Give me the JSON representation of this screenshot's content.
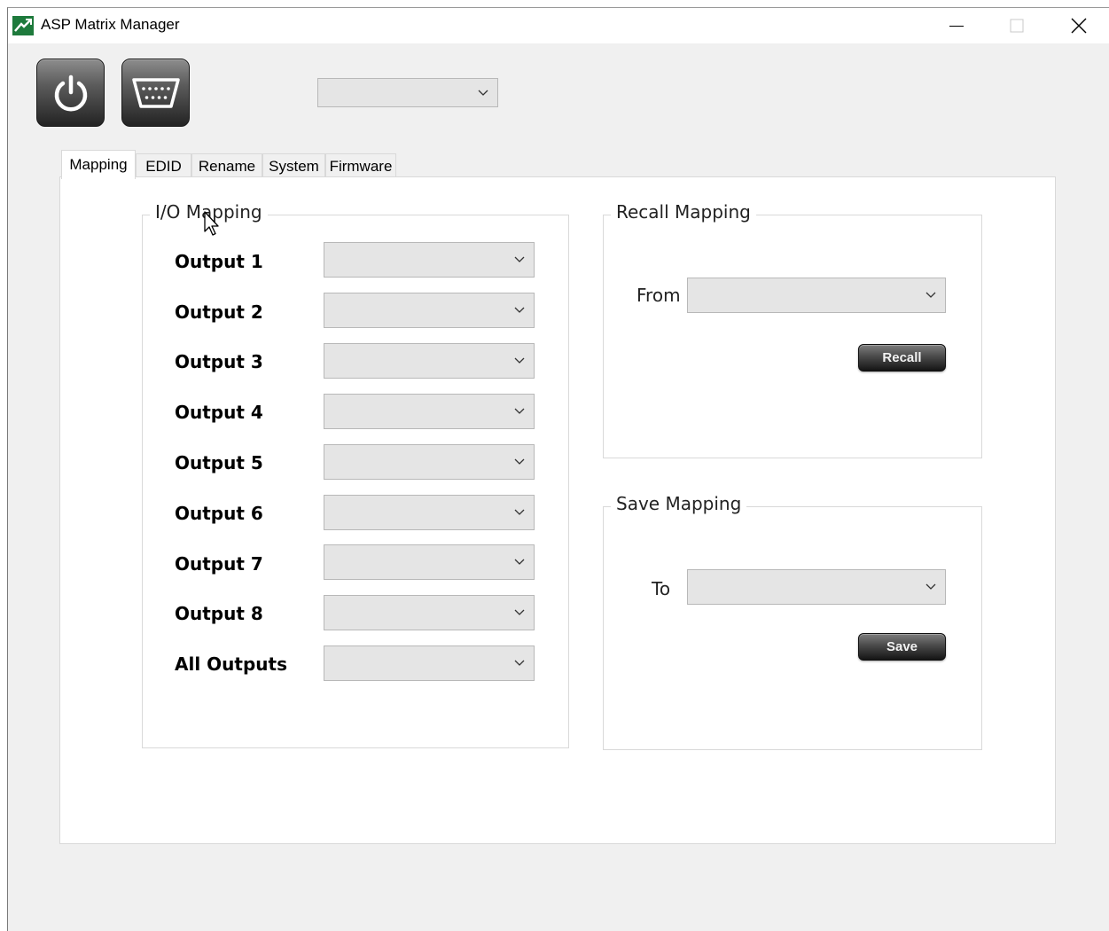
{
  "window": {
    "title": "ASP Matrix Manager",
    "controls": {
      "minimize": "minimize-icon",
      "maximize": "maximize-icon",
      "close": "close-icon"
    }
  },
  "toolbar": {
    "power_icon": "power-icon",
    "serial_icon": "serial-port-icon",
    "device_select_value": ""
  },
  "tabs": [
    {
      "label": "Mapping",
      "active": true
    },
    {
      "label": "EDID",
      "active": false
    },
    {
      "label": "Rename",
      "active": false
    },
    {
      "label": "System",
      "active": false
    },
    {
      "label": "Firmware",
      "active": false
    }
  ],
  "io_mapping": {
    "title": "I/O Mapping",
    "rows": [
      {
        "label": "Output 1",
        "value": ""
      },
      {
        "label": "Output 2",
        "value": ""
      },
      {
        "label": "Output 3",
        "value": ""
      },
      {
        "label": "Output 4",
        "value": ""
      },
      {
        "label": "Output 5",
        "value": ""
      },
      {
        "label": "Output 6",
        "value": ""
      },
      {
        "label": "Output 7",
        "value": ""
      },
      {
        "label": "Output 8",
        "value": ""
      },
      {
        "label": "All Outputs",
        "value": ""
      }
    ]
  },
  "recall_mapping": {
    "title": "Recall Mapping",
    "from_label": "From",
    "from_value": "",
    "button_label": "Recall"
  },
  "save_mapping": {
    "title": "Save Mapping",
    "to_label": "To",
    "to_value": "",
    "button_label": "Save"
  },
  "colors": {
    "logo_green": "#1e7a3c",
    "button_dark": "#232323",
    "combo_bg": "#e5e5e5"
  }
}
